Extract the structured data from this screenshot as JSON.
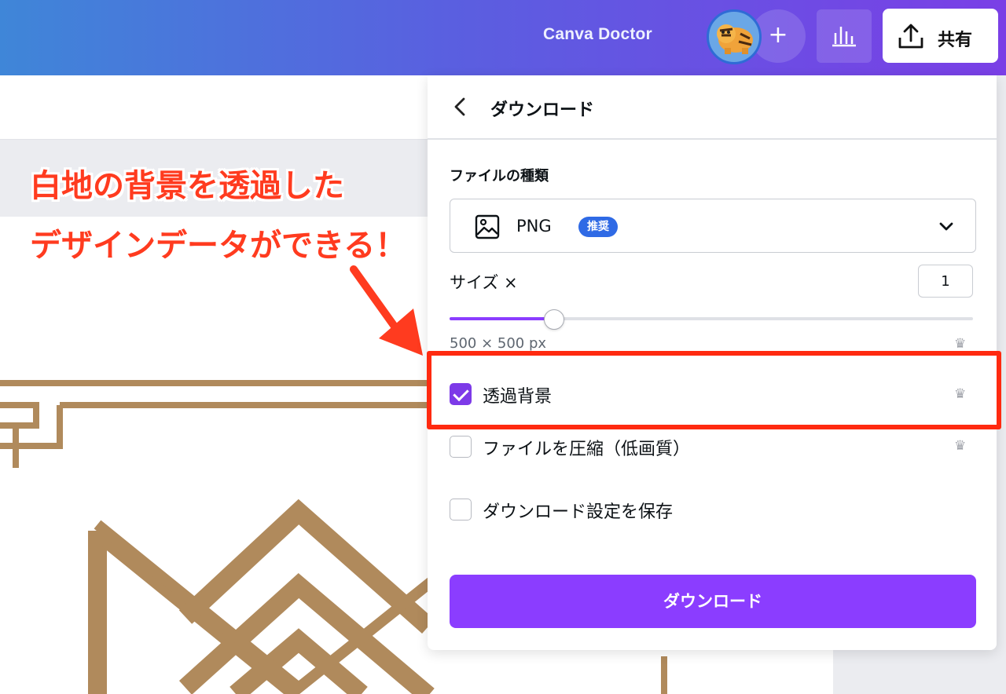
{
  "topbar": {
    "design_title": "Canva Doctor",
    "add_label": "+",
    "share_label": "共有"
  },
  "annotation": {
    "line1": "白地の背景を透過した",
    "line2": "デザインデータができる！"
  },
  "download_panel": {
    "title": "ダウンロード",
    "file_type_label": "ファイルの種類",
    "file_type_value": "PNG",
    "recommended_badge": "推奨",
    "size_label": "サイズ ×",
    "size_value": "1",
    "slider_level": 0.2,
    "dimensions": "500 × 500 px",
    "options": [
      {
        "label": "透過背景",
        "checked": true
      },
      {
        "label": "ファイルを圧縮（低画質）",
        "checked": false
      },
      {
        "label": "ダウンロード設定を保存",
        "checked": false
      }
    ],
    "download_button": "ダウンロード"
  },
  "colors": {
    "accent": "#8b3dff",
    "badge": "#2f6ae5",
    "highlight": "#ff2a10",
    "design_gold": "#b08a5c"
  },
  "icons": [
    "back-chevron-icon",
    "image-icon",
    "chevron-down-icon",
    "crown-icon",
    "share-upload-icon",
    "insights-chart-icon",
    "plus-icon",
    "checkmark-icon"
  ]
}
